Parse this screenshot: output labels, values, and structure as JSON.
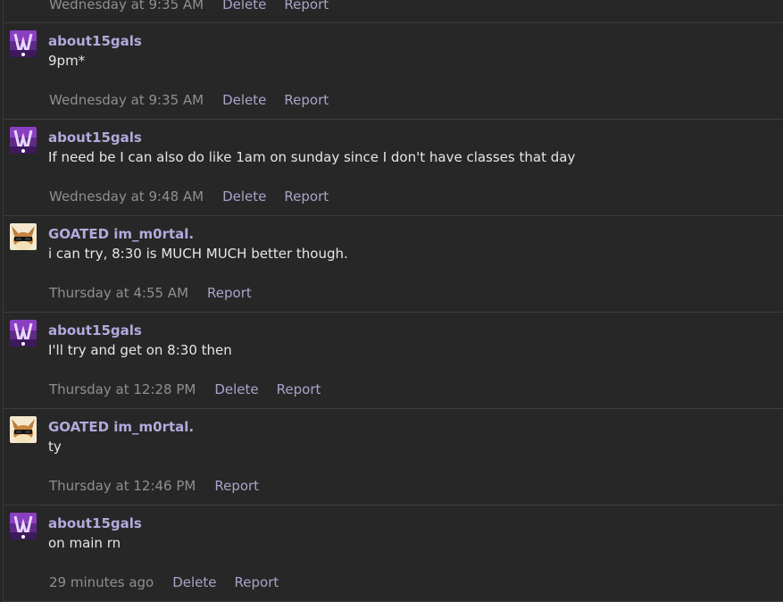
{
  "actions": {
    "delete": "Delete",
    "report": "Report"
  },
  "colors": {
    "author": "#b3a9dc",
    "timestamp": "#8f8f8f",
    "action": "#a9a3c9",
    "background": "#272727"
  },
  "messages": [
    {
      "author": "",
      "avatar": "none",
      "text": "",
      "time": "Wednesday at 9:35 AM",
      "can_delete": true
    },
    {
      "author": "about15gals",
      "avatar": "purple-avatar",
      "text": "9pm*",
      "time": "Wednesday at 9:35 AM",
      "can_delete": true
    },
    {
      "author": "about15gals",
      "avatar": "purple-avatar",
      "text": "If need be I can also do like 1am on sunday since I don't have classes that day",
      "time": "Wednesday at 9:48 AM",
      "can_delete": true
    },
    {
      "author": "GOATED im_m0rtal.",
      "avatar": "eevee-sunglasses-avatar",
      "text": "i can try, 8:30 is MUCH MUCH better though.",
      "time": "Thursday at 4:55 AM",
      "can_delete": false
    },
    {
      "author": "about15gals",
      "avatar": "purple-avatar",
      "text": "I'll try and get on 8:30 then",
      "time": "Thursday at 12:28 PM",
      "can_delete": true
    },
    {
      "author": "GOATED im_m0rtal.",
      "avatar": "eevee-sunglasses-avatar",
      "text": "ty",
      "time": "Thursday at 12:46 PM",
      "can_delete": false
    },
    {
      "author": "about15gals",
      "avatar": "purple-avatar",
      "text": "on main rn",
      "time": "29 minutes ago",
      "can_delete": true
    }
  ]
}
